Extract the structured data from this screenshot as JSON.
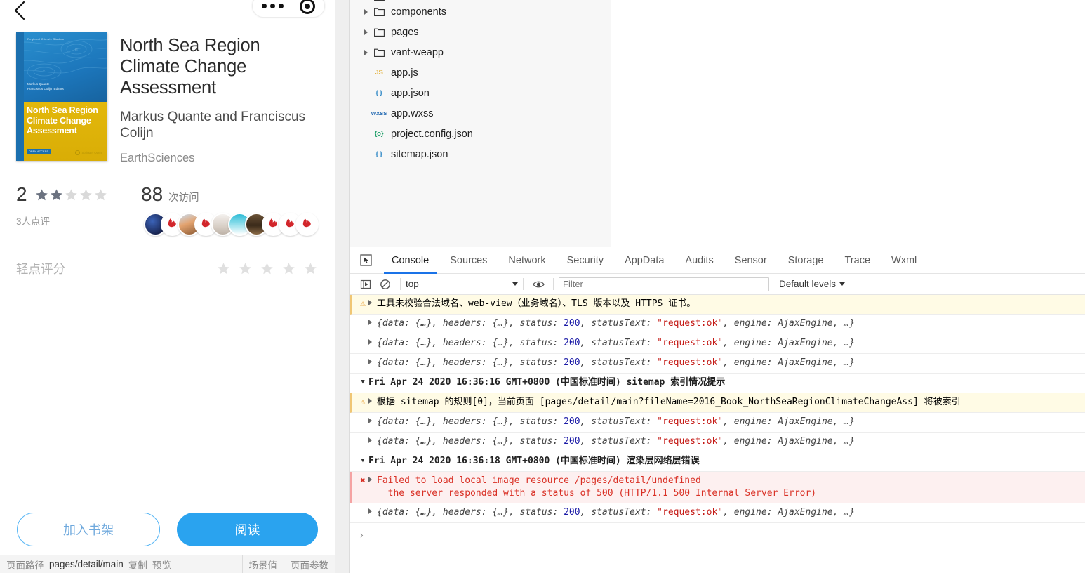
{
  "simulator": {
    "nav": {
      "back_icon": "chevron-left-icon",
      "more_icon": "more-dots-icon",
      "target_icon": "target-circle-icon"
    },
    "book": {
      "title": "North Sea Region Climate Change Assessment",
      "author": "Markus Quante and Franciscus Colijn",
      "subject": "EarthSciences",
      "cover": {
        "series": "Regional Climate Studies",
        "editors": "Markus Quante\nFranciscus Colijn  Editors",
        "title": "North Sea Region\nClimate Change\nAssessment",
        "open_access": "OPEN ACCESS",
        "publisher": "Springer Open"
      }
    },
    "rating": {
      "score": "2",
      "stars_filled": 2,
      "stars_total": 5,
      "review_count_label": "3人点评"
    },
    "visits": {
      "count": "88",
      "label": "次访问",
      "avatar_count": 10
    },
    "tap_rate": {
      "label": "轻点评分",
      "stars_total": 5
    },
    "buttons": {
      "add_shelf": "加入书架",
      "read": "阅读"
    },
    "colors": {
      "primary": "#2aa3ef",
      "outline": "#57b6f5",
      "cover_blue": "#1c76bb",
      "cover_gold": "#dcb00a"
    }
  },
  "statusbar": {
    "path_label": "页面路径",
    "path_value": "pages/detail/main",
    "copy": "复制",
    "preview": "预览",
    "scene_value": "场景值",
    "page_params": "页面参数"
  },
  "devtools": {
    "tree": [
      {
        "name": "components",
        "type": "folder",
        "expandable": true
      },
      {
        "name": "pages",
        "type": "folder",
        "expandable": true
      },
      {
        "name": "vant-weapp",
        "type": "folder",
        "expandable": true
      },
      {
        "name": "app.js",
        "type": "js",
        "icon_text": "JS",
        "expandable": false
      },
      {
        "name": "app.json",
        "type": "json",
        "icon_text": "{ }",
        "expandable": false
      },
      {
        "name": "app.wxss",
        "type": "wxss",
        "icon_text": "wxss",
        "expandable": false
      },
      {
        "name": "project.config.json",
        "type": "config",
        "icon_text": "{o}",
        "expandable": false
      },
      {
        "name": "sitemap.json",
        "type": "json",
        "icon_text": "{ }",
        "expandable": false
      }
    ],
    "tabs": [
      {
        "label": "Console",
        "active": true
      },
      {
        "label": "Sources",
        "active": false
      },
      {
        "label": "Network",
        "active": false
      },
      {
        "label": "Security",
        "active": false
      },
      {
        "label": "AppData",
        "active": false
      },
      {
        "label": "Audits",
        "active": false
      },
      {
        "label": "Sensor",
        "active": false
      },
      {
        "label": "Storage",
        "active": false
      },
      {
        "label": "Trace",
        "active": false
      },
      {
        "label": "Wxml",
        "active": false
      }
    ],
    "console_toolbar": {
      "execute_icon": "execute-step-icon",
      "clear_icon": "clear-console-icon",
      "context": "top",
      "eye_icon": "live-expression-eye-icon",
      "filter_placeholder": "Filter",
      "filter_value": "",
      "levels": "Default levels"
    },
    "console_rows": [
      {
        "kind": "warn",
        "text": "工具未校验合法域名、web-view（业务域名）、TLS 版本以及 HTTPS 证书。"
      },
      {
        "kind": "obj"
      },
      {
        "kind": "obj"
      },
      {
        "kind": "obj"
      },
      {
        "kind": "group",
        "text": "Fri Apr 24 2020 16:36:16 GMT+0800 (中国标准时间) sitemap 索引情况提示"
      },
      {
        "kind": "warn",
        "text": "根据 sitemap 的规则[0]，当前页面 [pages/detail/main?fileName=2016_Book_NorthSeaRegionClimateChangeAss] 将被索引"
      },
      {
        "kind": "obj"
      },
      {
        "kind": "obj"
      },
      {
        "kind": "group",
        "text": "Fri Apr 24 2020 16:36:18 GMT+0800 (中国标准时间) 渲染层网络层错误"
      },
      {
        "kind": "error",
        "line1": "Failed to load local image resource /pages/detail/undefined",
        "line2": "the server responded with a status of 500 (HTTP/1.1 500 Internal Server Error)"
      },
      {
        "kind": "obj"
      }
    ],
    "object_row": {
      "prefix": "{data: {…}, headers: {…}, status: ",
      "status": "200",
      "mid": ", statusText: ",
      "status_text": "\"request:ok\"",
      "suffix": ", engine: AjaxEngine, …}"
    },
    "prompt": "›"
  }
}
